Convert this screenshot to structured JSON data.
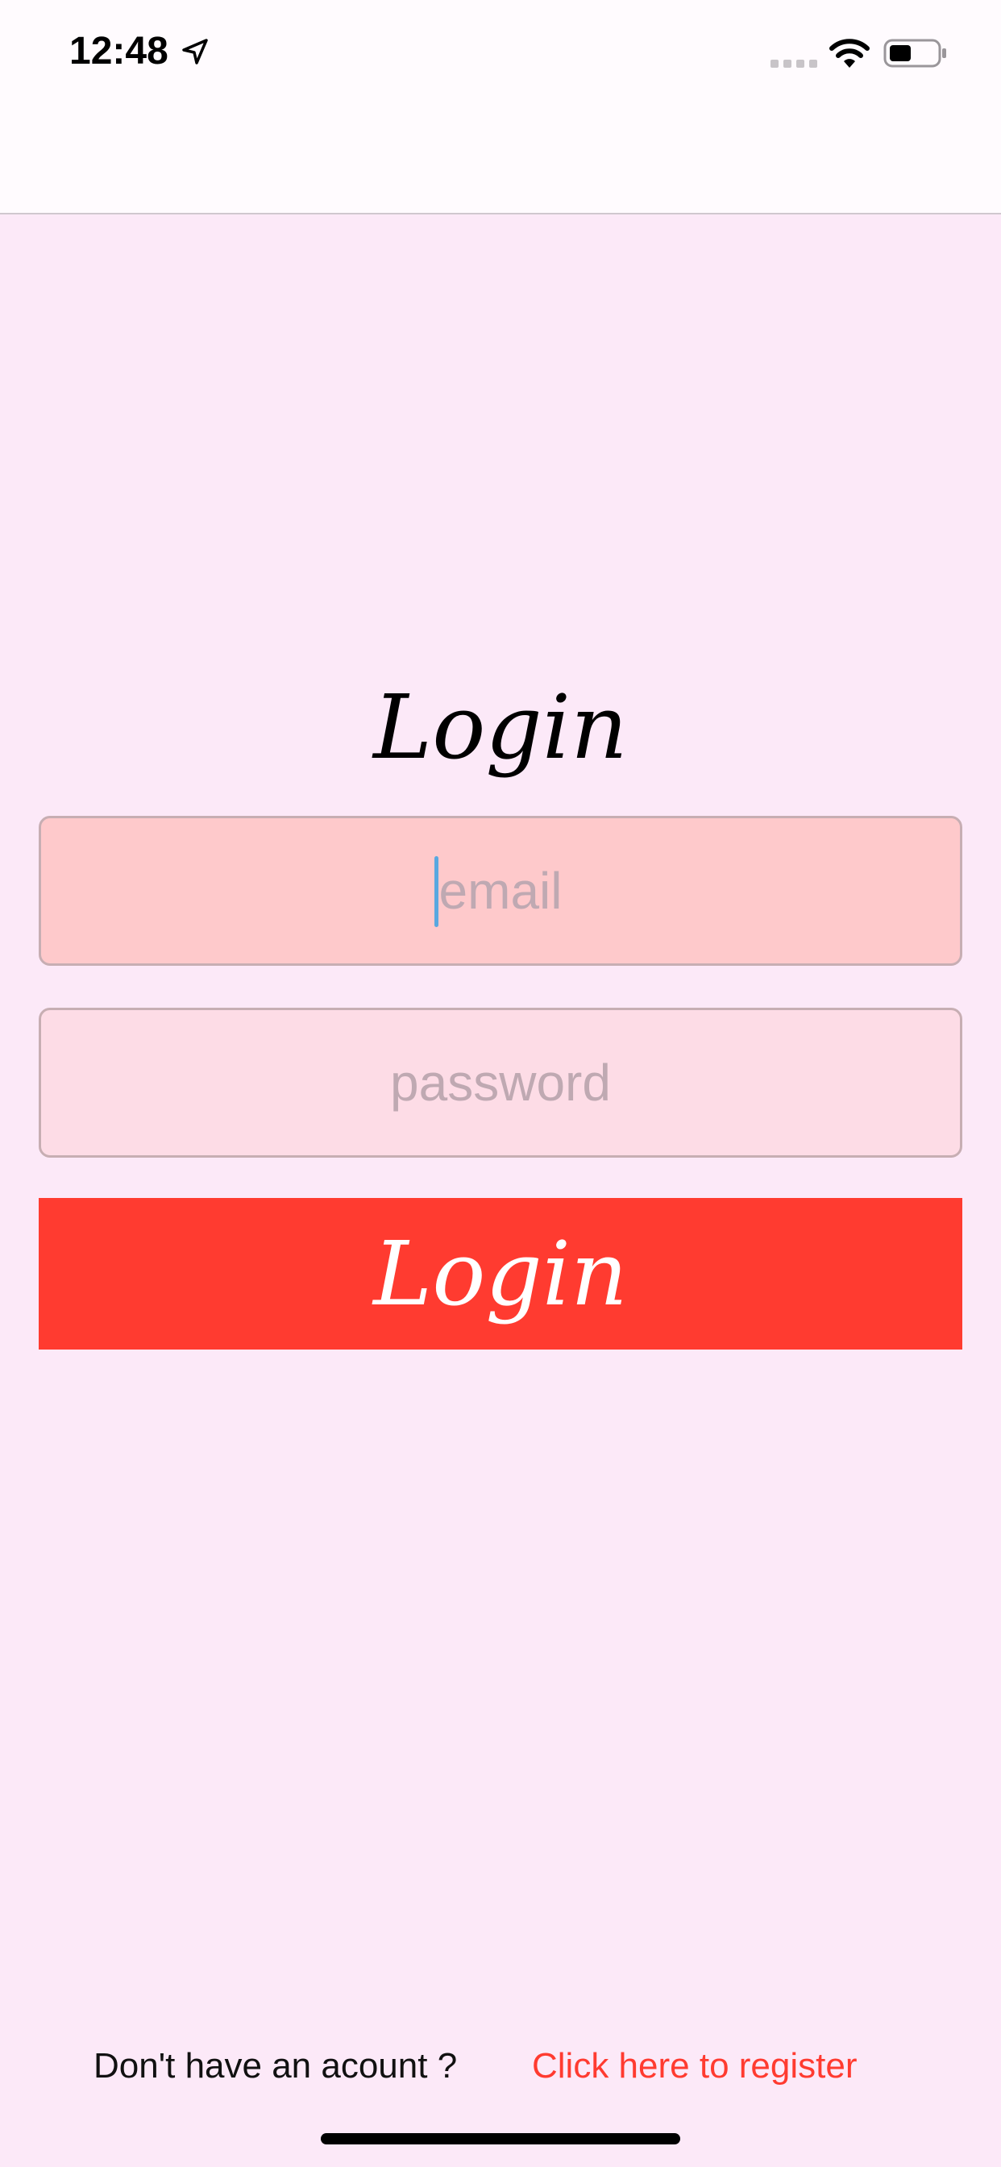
{
  "status_bar": {
    "time": "12:48"
  },
  "icons": {
    "location": "location-arrow-icon",
    "signal": "cellular-signal-icon",
    "wifi": "wifi-icon",
    "battery": "battery-icon"
  },
  "login": {
    "title": "Login",
    "email_placeholder": "email",
    "password_placeholder": "password",
    "button_label": "Login"
  },
  "footer": {
    "prompt": "Don't have an acount ?",
    "register_link": "Click here to register"
  },
  "colors": {
    "background": "#fce9f8",
    "accent": "#ff3b30",
    "email_field": "#fec9cb",
    "password_field": "#fddce6"
  }
}
